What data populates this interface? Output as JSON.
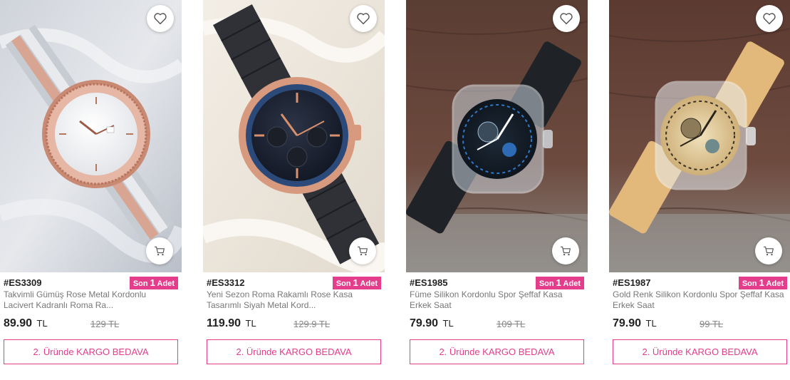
{
  "products": [
    {
      "code": "#ES3309",
      "stock_badge": {
        "prefix": "Son",
        "count": "1",
        "suffix": "Adet"
      },
      "title": "Takvimli Gümüş Rose Metal Kordonlu Lacivert Kadranlı Roma Ra...",
      "price": "89.90",
      "currency": "TL",
      "old_price": "129 TL",
      "promo": "2. Üründe KARGO BEDAVA"
    },
    {
      "code": "#ES3312",
      "stock_badge": {
        "prefix": "Son",
        "count": "1",
        "suffix": "Adet"
      },
      "title": "Yeni Sezon Roma Rakamlı Rose Kasa Tasarımlı Siyah Metal Kord...",
      "price": "119.90",
      "currency": "TL",
      "old_price": "129.9 TL",
      "promo": "2. Üründe KARGO BEDAVA"
    },
    {
      "code": "#ES1985",
      "stock_badge": {
        "prefix": "Son",
        "count": "1",
        "suffix": "Adet"
      },
      "title": "Füme Silikon Kordonlu Spor Şeffaf Kasa Erkek Saat",
      "price": "79.90",
      "currency": "TL",
      "old_price": "109 TL",
      "promo": "2. Üründe KARGO BEDAVA"
    },
    {
      "code": "#ES1987",
      "stock_badge": {
        "prefix": "Son",
        "count": "1",
        "suffix": "Adet"
      },
      "title": "Gold Renk Silikon Kordonlu Spor Şeffaf Kasa Erkek Saat",
      "price": "79.90",
      "currency": "TL",
      "old_price": "99 TL",
      "promo": "2. Üründe KARGO BEDAVA"
    }
  ],
  "icons": {
    "favorite": "heart-outline-icon",
    "cart": "shopping-cart-icon"
  },
  "colors": {
    "accent": "#e33d8c",
    "text": "#222222",
    "muted": "#777777"
  }
}
